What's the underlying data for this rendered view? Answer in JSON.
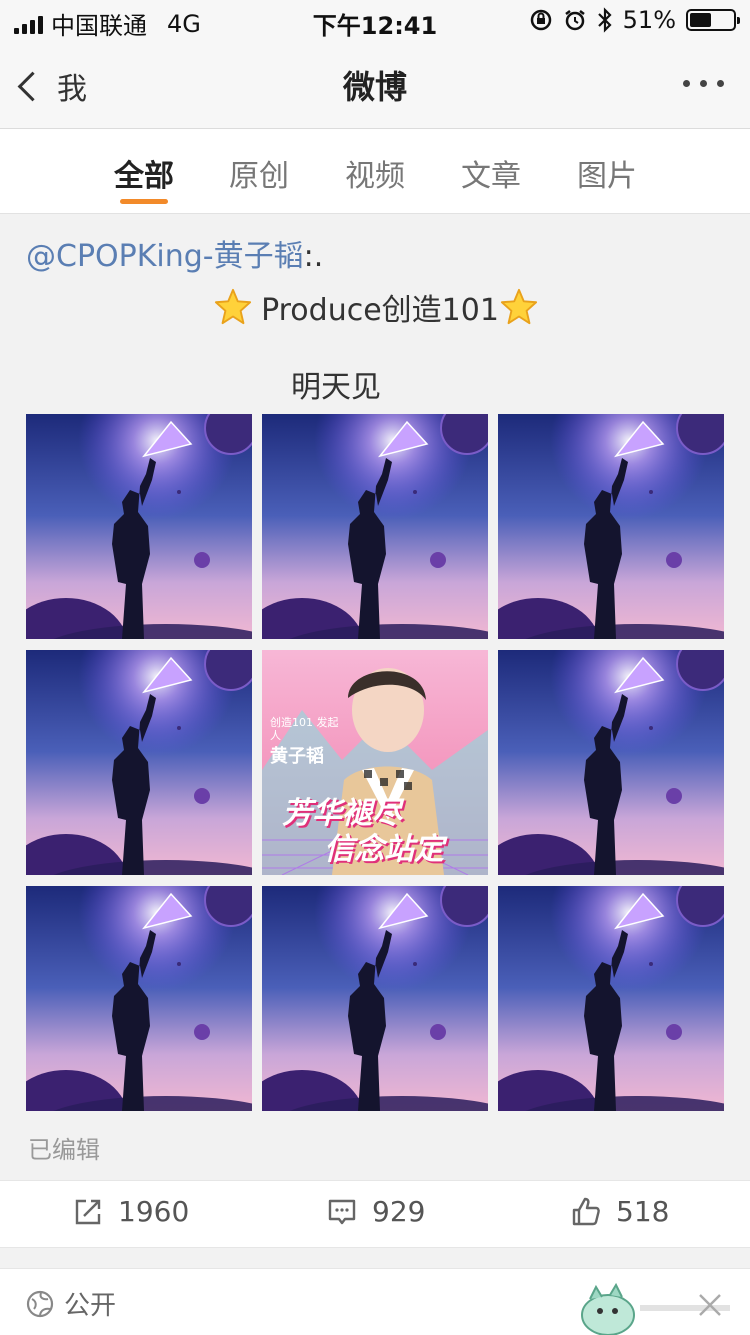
{
  "status_bar": {
    "carrier": "中国联通",
    "network": "4G",
    "time": "下午12:41",
    "battery": "51%",
    "battery_level": 0.51
  },
  "nav": {
    "back_label": "我",
    "title": "微博"
  },
  "tabs": [
    {
      "label": "全部",
      "active": true
    },
    {
      "label": "原创",
      "active": false
    },
    {
      "label": "视频",
      "active": false
    },
    {
      "label": "文章",
      "active": false
    },
    {
      "label": "图片",
      "active": false
    }
  ],
  "post": {
    "mention": "@CPOPKing-黄子韬",
    "mention_suffix": ":.",
    "headline": "Produce创造101",
    "line3": "明天见",
    "edited": "已编辑"
  },
  "images": {
    "count": 9,
    "featured_index": 4,
    "featured_text_name": "黄子韬",
    "featured_text_small": "创造101 发起人",
    "featured_slogan_1": "芳华褪尽",
    "featured_slogan_2": "信念站定"
  },
  "actions": {
    "repost_count": "1960",
    "comment_count": "929",
    "like_count": "518"
  },
  "visibility": {
    "label": "公开"
  },
  "icons": [
    "signal-icon",
    "lock-rotation-icon",
    "alarm-icon",
    "bluetooth-icon",
    "battery-icon",
    "back-chevron-icon",
    "more-icon",
    "star-icon",
    "repost-icon",
    "comment-icon",
    "like-icon",
    "globe-icon",
    "close-icon"
  ],
  "colors": {
    "accent": "#f28a2a",
    "mention": "#5a7eb3"
  }
}
